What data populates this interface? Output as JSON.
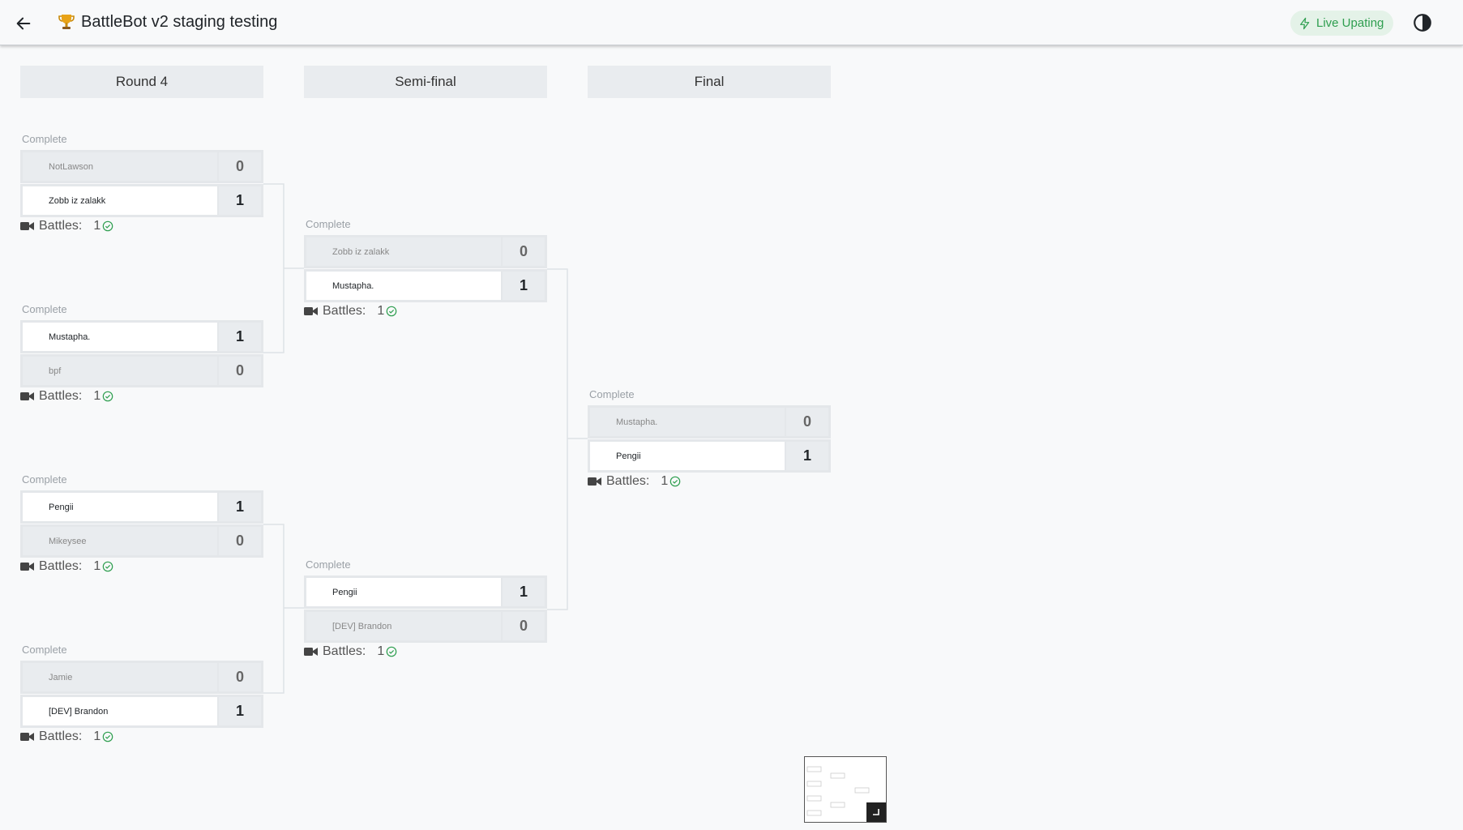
{
  "header": {
    "back_icon": "arrow-left-icon",
    "trophy_icon": "trophy-icon",
    "title": "BattleBot v2 staging testing",
    "live_label": "Live Upating",
    "live_icon": "lightning-icon",
    "theme_icon": "contrast-icon"
  },
  "colors": {
    "accent_green": "#2e9e4f",
    "header_bg": "#f8f9fa",
    "round_bg": "#e9ecef"
  },
  "rounds": [
    {
      "name": "Round 4"
    },
    {
      "name": "Semi-final"
    },
    {
      "name": "Final"
    }
  ],
  "matches": {
    "r4m1": {
      "status": "Complete",
      "team1": {
        "name": "NotLawson",
        "score": "0"
      },
      "team2": {
        "name": "Zobb iz zalakk",
        "score": "1"
      },
      "battles_label": "Battles:",
      "battles_count": "1"
    },
    "r4m2": {
      "status": "Complete",
      "team1": {
        "name": "Mustapha.",
        "score": "1"
      },
      "team2": {
        "name": "bpf",
        "score": "0"
      },
      "battles_label": "Battles:",
      "battles_count": "1"
    },
    "r4m3": {
      "status": "Complete",
      "team1": {
        "name": "Pengii",
        "score": "1"
      },
      "team2": {
        "name": "Mikeysee",
        "score": "0"
      },
      "battles_label": "Battles:",
      "battles_count": "1"
    },
    "r4m4": {
      "status": "Complete",
      "team1": {
        "name": "Jamie",
        "score": "0"
      },
      "team2": {
        "name": "[DEV] Brandon",
        "score": "1"
      },
      "battles_label": "Battles:",
      "battles_count": "1"
    },
    "sf1": {
      "status": "Complete",
      "team1": {
        "name": "Zobb iz zalakk",
        "score": "0"
      },
      "team2": {
        "name": "Mustapha.",
        "score": "1"
      },
      "battles_label": "Battles:",
      "battles_count": "1"
    },
    "sf2": {
      "status": "Complete",
      "team1": {
        "name": "Pengii",
        "score": "1"
      },
      "team2": {
        "name": "[DEV] Brandon",
        "score": "0"
      },
      "battles_label": "Battles:",
      "battles_count": "1"
    },
    "final": {
      "status": "Complete",
      "team1": {
        "name": "Mustapha.",
        "score": "0"
      },
      "team2": {
        "name": "Pengii",
        "score": "1"
      },
      "battles_label": "Battles:",
      "battles_count": "1"
    }
  }
}
